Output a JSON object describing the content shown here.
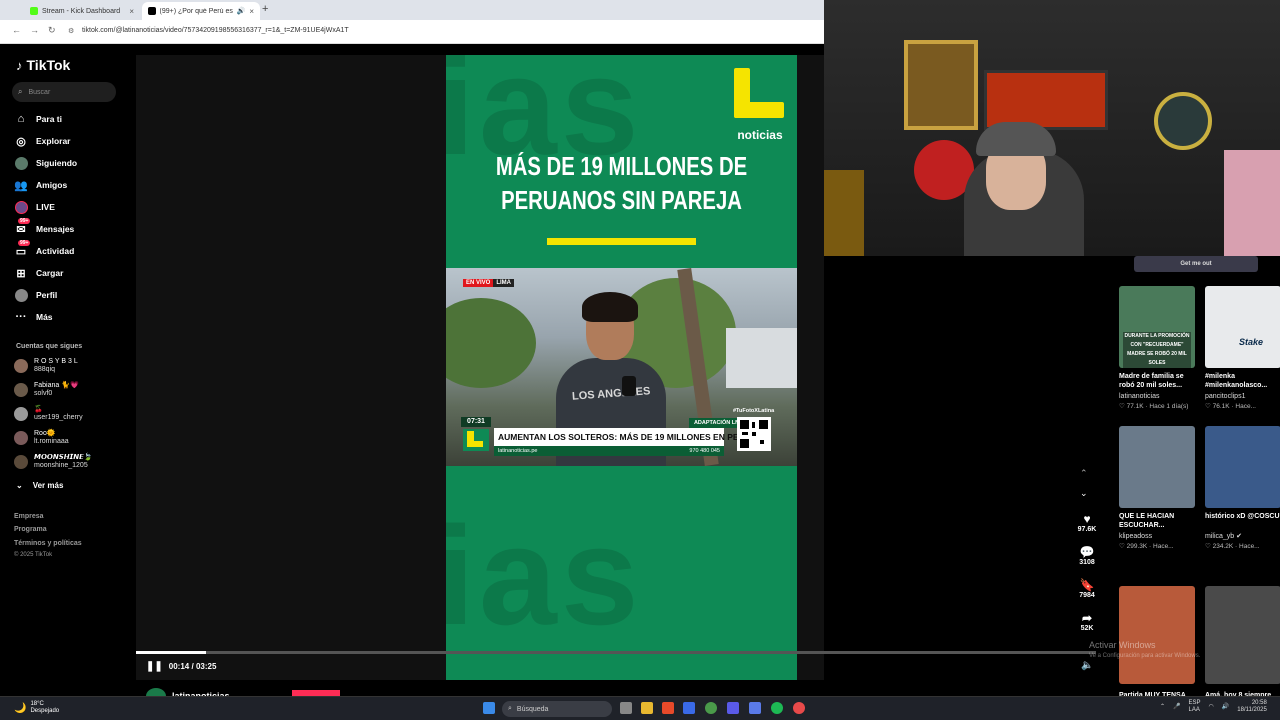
{
  "browser": {
    "tabs": [
      {
        "title": "Stream - Kick Dashboard",
        "close": "×"
      },
      {
        "title": "(99+) ¿Por qué Perú es un p...",
        "close": "×"
      }
    ],
    "new_tab": "+",
    "url": "tiktok.com/@latinanoticias/video/75734209198556316377_r=1&_t=ZM-91UE4jWxA1T"
  },
  "tiktok": {
    "logo": "TikTok",
    "search_placeholder": "Buscar",
    "nav": [
      {
        "label": "Para ti",
        "icon": "home-icon"
      },
      {
        "label": "Explorar",
        "icon": "compass-icon"
      },
      {
        "label": "Siguiendo",
        "icon": "following-avatar-icon"
      },
      {
        "label": "Amigos",
        "icon": "friends-icon"
      },
      {
        "label": "LIVE",
        "icon": "live-icon"
      },
      {
        "label": "Mensajes",
        "icon": "messages-icon",
        "badge": "99+"
      },
      {
        "label": "Actividad",
        "icon": "activity-icon",
        "badge": "99+"
      },
      {
        "label": "Cargar",
        "icon": "upload-icon"
      },
      {
        "label": "Perfil",
        "icon": "profile-icon"
      },
      {
        "label": "Más",
        "icon": "more-icon"
      }
    ],
    "following_title": "Cuentas que sigues",
    "accounts": [
      {
        "name": "R O S Y B 3 L",
        "handle": "888qiq"
      },
      {
        "name": "Fabiana 🐈💗",
        "handle": "solvf0"
      },
      {
        "name": "🍒",
        "handle": "user199_cherry"
      },
      {
        "name": "Roo🌞",
        "handle": "lt.rominaaa"
      },
      {
        "name": "𝙈𝙊𝙊𝙉𝙎𝙃𝙄𝙉𝙀🍃",
        "handle": "moonshine_1205"
      }
    ],
    "see_more": "Ver más",
    "footer": [
      "Empresa",
      "Programa",
      "Términos y políticas",
      "© 2025 TikTok"
    ]
  },
  "video": {
    "bg_word": "ias",
    "brand_name": "noticias",
    "headline_line1": "MÁS DE 19 MILLONES DE",
    "headline_line2": "PERUANOS SIN PAREJA",
    "live_label": "EN VIVO",
    "live_location": "LIMA",
    "hoodie_text": "LOS ANGELES",
    "clip_time": "07:31",
    "adaptation_label": "ADAPTACIÓN LN",
    "hashtag": "#TuFotoXLatina",
    "lower_headline": "AUMENTAN LOS SOLTEROS: MÁS DE 19 MILLONES EN PERÚ",
    "ticker_site": "latinanoticias.pe",
    "ticker_phone": "970 480 045",
    "progress": 0.073,
    "time_current": "00:14",
    "time_total": "03:25",
    "time_sep": "/"
  },
  "actions": {
    "likes": "97.6K",
    "comments": "3108",
    "saves": "7984",
    "shares": "52K"
  },
  "recommendations": {
    "get_me_out": "Get me out",
    "cards": [
      {
        "title": "Madre de familia se robó 20 mil soles...",
        "user": "latinanoticias",
        "meta": "♡ 77.1K · Hace 1 día(s)",
        "thumb_text": "DURANTE LA PROMOCIÓN CON \"RECUERDAME\" MADRE SE ROBÓ 20 MIL SOLES"
      },
      {
        "title": "#milenka #milenkanolasco...",
        "user": "pancitoclips1",
        "meta": "♡ 76.1K · Hace...",
        "thumb_text": "Stake"
      },
      {
        "title": "QUE LE HACIAN ESCUCHAR...",
        "user": "klipeadoss",
        "meta": "♡ 299.3K · Hace...",
        "thumb_text": ""
      },
      {
        "title": "histórico xD @COSCU",
        "user": "milica_yb ✔",
        "meta": "♡ 234.2K · Hace...",
        "thumb_text": ""
      },
      {
        "title": "Partida MUY TENSA",
        "user": "",
        "meta": "",
        "thumb_text": ""
      },
      {
        "title": "Amá, hoy 8 siempre",
        "user": "",
        "meta": "",
        "thumb_text": ""
      }
    ]
  },
  "watermark": {
    "title": "Activar Windows",
    "subtitle": "Ve a Configuración para activar Windows."
  },
  "bottom_peek": {
    "name": "latinanoticias"
  },
  "taskbar": {
    "temperature": "18°C",
    "weather": "Despejado",
    "search": "Búsqueda",
    "lang": "ESP",
    "lang_sub": "LAA",
    "time": "20:58",
    "date": "18/11/2025"
  },
  "colors": {
    "brand_green": "#0e8a55",
    "brand_yellow": "#f5e400",
    "tiktok_red": "#fe2c55"
  }
}
